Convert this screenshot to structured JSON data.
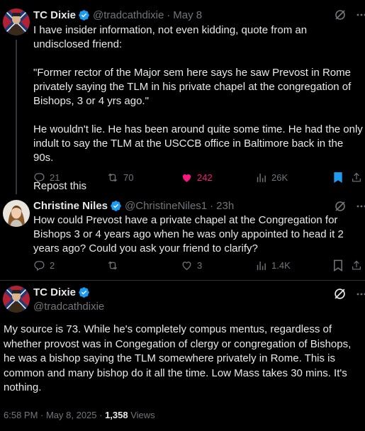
{
  "post1": {
    "name": "TC Dixie",
    "handle": "@tradcathdixie",
    "separator": "·",
    "time": "May 8",
    "paragraphs": [
      "I have insider information, not even kidding, quote from an undisclosed friend:",
      "\"Former rector of the Major sem here says he saw Prevost in Rome privately saying the TLM in his private chapel at the congregation of Bishops, 3 or 4 yrs ago.\"",
      "He wouldn't lie. He has been around quite some time. He had the only indult to say the TLM at the USCCB office in Baltimore back in the 90s.",
      "Repost this"
    ],
    "actions": {
      "replies": "21",
      "reposts": "70",
      "likes": "242",
      "views": "26K"
    }
  },
  "post2": {
    "name": "Christine Niles",
    "handle": "@ChristineNiles1",
    "separator": "·",
    "time": "23h",
    "text": "How could Prevost have a private chapel at the Congregation for Bishops 3 or 4 years ago when he was only appointed to head it 2 years ago? Could you ask your friend to clarify?",
    "actions": {
      "replies": "2",
      "reposts": "",
      "likes": "3",
      "views": "1.4K"
    }
  },
  "post3": {
    "name": "TC Dixie",
    "handle": "@tradcathdixie",
    "text": "My source is 73. While he's completely compus mentus, regardless of whether provost was in Congegation of clergy or congregation of Bishops, he was a bishop saying the TLM somewhere privately in Rome. This is common and many bishop do it all the time. Low Mass takes 30 mins. It's nothing.",
    "timestamp": "6:58 PM · May 8, 2025 · ",
    "views_count": "1,358",
    "views_label": " Views"
  },
  "colors": {
    "background": "#000000",
    "text": "#e7e9ea",
    "secondary": "#71767b",
    "verified": "#1d9bf0",
    "like": "#f91880",
    "bookmark": "#1d9bf0"
  },
  "icons": [
    "verified-badge-icon",
    "grok-icon",
    "more-icon",
    "reply-icon",
    "repost-icon",
    "like-icon",
    "views-icon",
    "bookmark-icon",
    "share-icon"
  ]
}
